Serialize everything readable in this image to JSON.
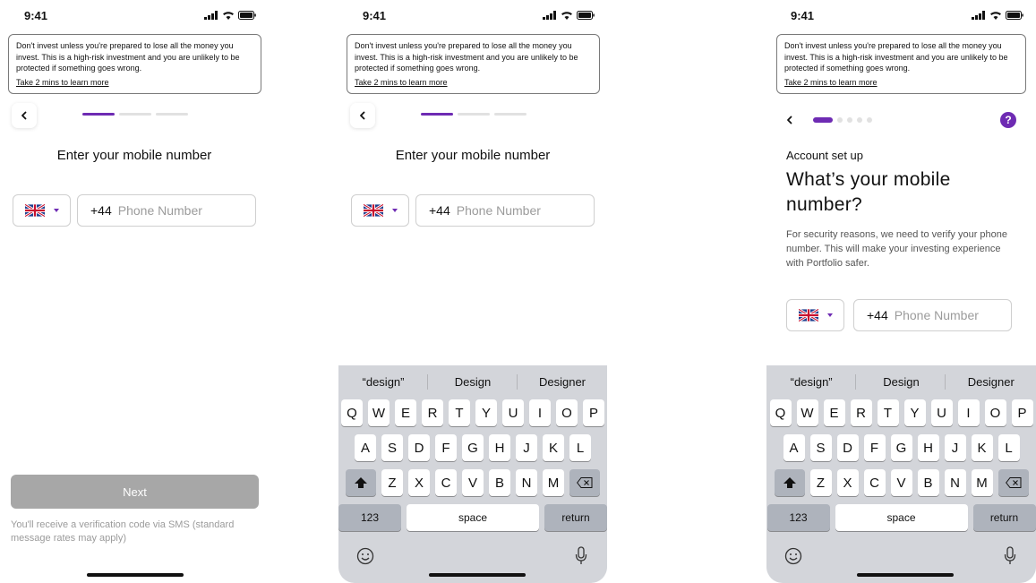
{
  "status": {
    "time": "9:41"
  },
  "risk": {
    "text": "Don't invest unless you're prepared to lose all the money you invest. This is a high-risk investment and you are unlikely to be protected if something goes wrong.",
    "link": "Take 2 mins to learn more"
  },
  "screen1": {
    "heading": "Enter your mobile number",
    "country_code": "+44",
    "phone_placeholder": "Phone Number",
    "next_label": "Next",
    "sms_note": "You'll receive a verification code via SMS (standard message rates may apply)"
  },
  "screen2": {
    "heading": "Enter your mobile number",
    "country_code": "+44",
    "phone_placeholder": "Phone Number"
  },
  "screen3": {
    "eyebrow": "Account set up",
    "title": "What’s your mobile number?",
    "description": "For security reasons, we need to verify your phone number. This will make your investing experience with Portfolio safer.",
    "help": "?",
    "country_code": "+44",
    "phone_placeholder": "Phone Number"
  },
  "keyboard": {
    "suggestions": [
      "“design”",
      "Design",
      "Designer"
    ],
    "row1": [
      "Q",
      "W",
      "E",
      "R",
      "T",
      "Y",
      "U",
      "I",
      "O",
      "P"
    ],
    "row2": [
      "A",
      "S",
      "D",
      "F",
      "G",
      "H",
      "J",
      "K",
      "L"
    ],
    "row3": [
      "Z",
      "X",
      "C",
      "V",
      "B",
      "N",
      "M"
    ],
    "numbers": "123",
    "space": "space",
    "return": "return"
  },
  "colors": {
    "accent": "#6e2bb3",
    "disabled_button": "#a7a7a7",
    "keyboard_bg": "#d3d5da"
  },
  "icons": [
    "back-chevron-icon",
    "uk-flag-icon",
    "dropdown-caret-icon",
    "help-icon",
    "shift-icon",
    "delete-icon",
    "emoji-icon",
    "mic-icon",
    "signal-icon",
    "wifi-icon",
    "battery-icon"
  ]
}
